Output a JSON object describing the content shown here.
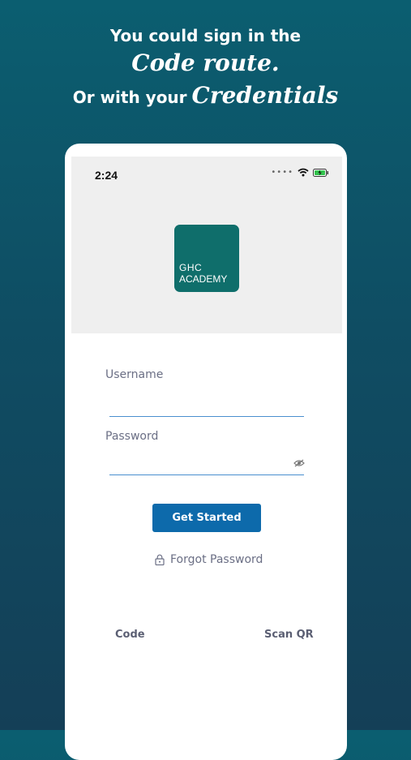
{
  "promo": {
    "line1": "You could sign in the",
    "line2": "Code route.",
    "line3_prefix": "Or with your",
    "line3_script": "Credentials"
  },
  "status_bar": {
    "time": "2:24",
    "icons": [
      "signal-dots-icon",
      "wifi-icon",
      "battery-charging-icon"
    ]
  },
  "logo": {
    "line1": "GHC",
    "line2": "ACADEMY",
    "color": "#0f6e6b"
  },
  "form": {
    "username_label": "Username",
    "username_value": "",
    "password_label": "Password",
    "password_value": "",
    "submit_label": "Get Started",
    "forgot_label": "Forgot Password"
  },
  "footer": {
    "code_label": "Code",
    "scan_label": "Scan QR"
  },
  "colors": {
    "background_top": "#0b5e70",
    "background_bottom": "#143f57",
    "accent": "#0d6aab",
    "underline": "#4a8fcf"
  }
}
